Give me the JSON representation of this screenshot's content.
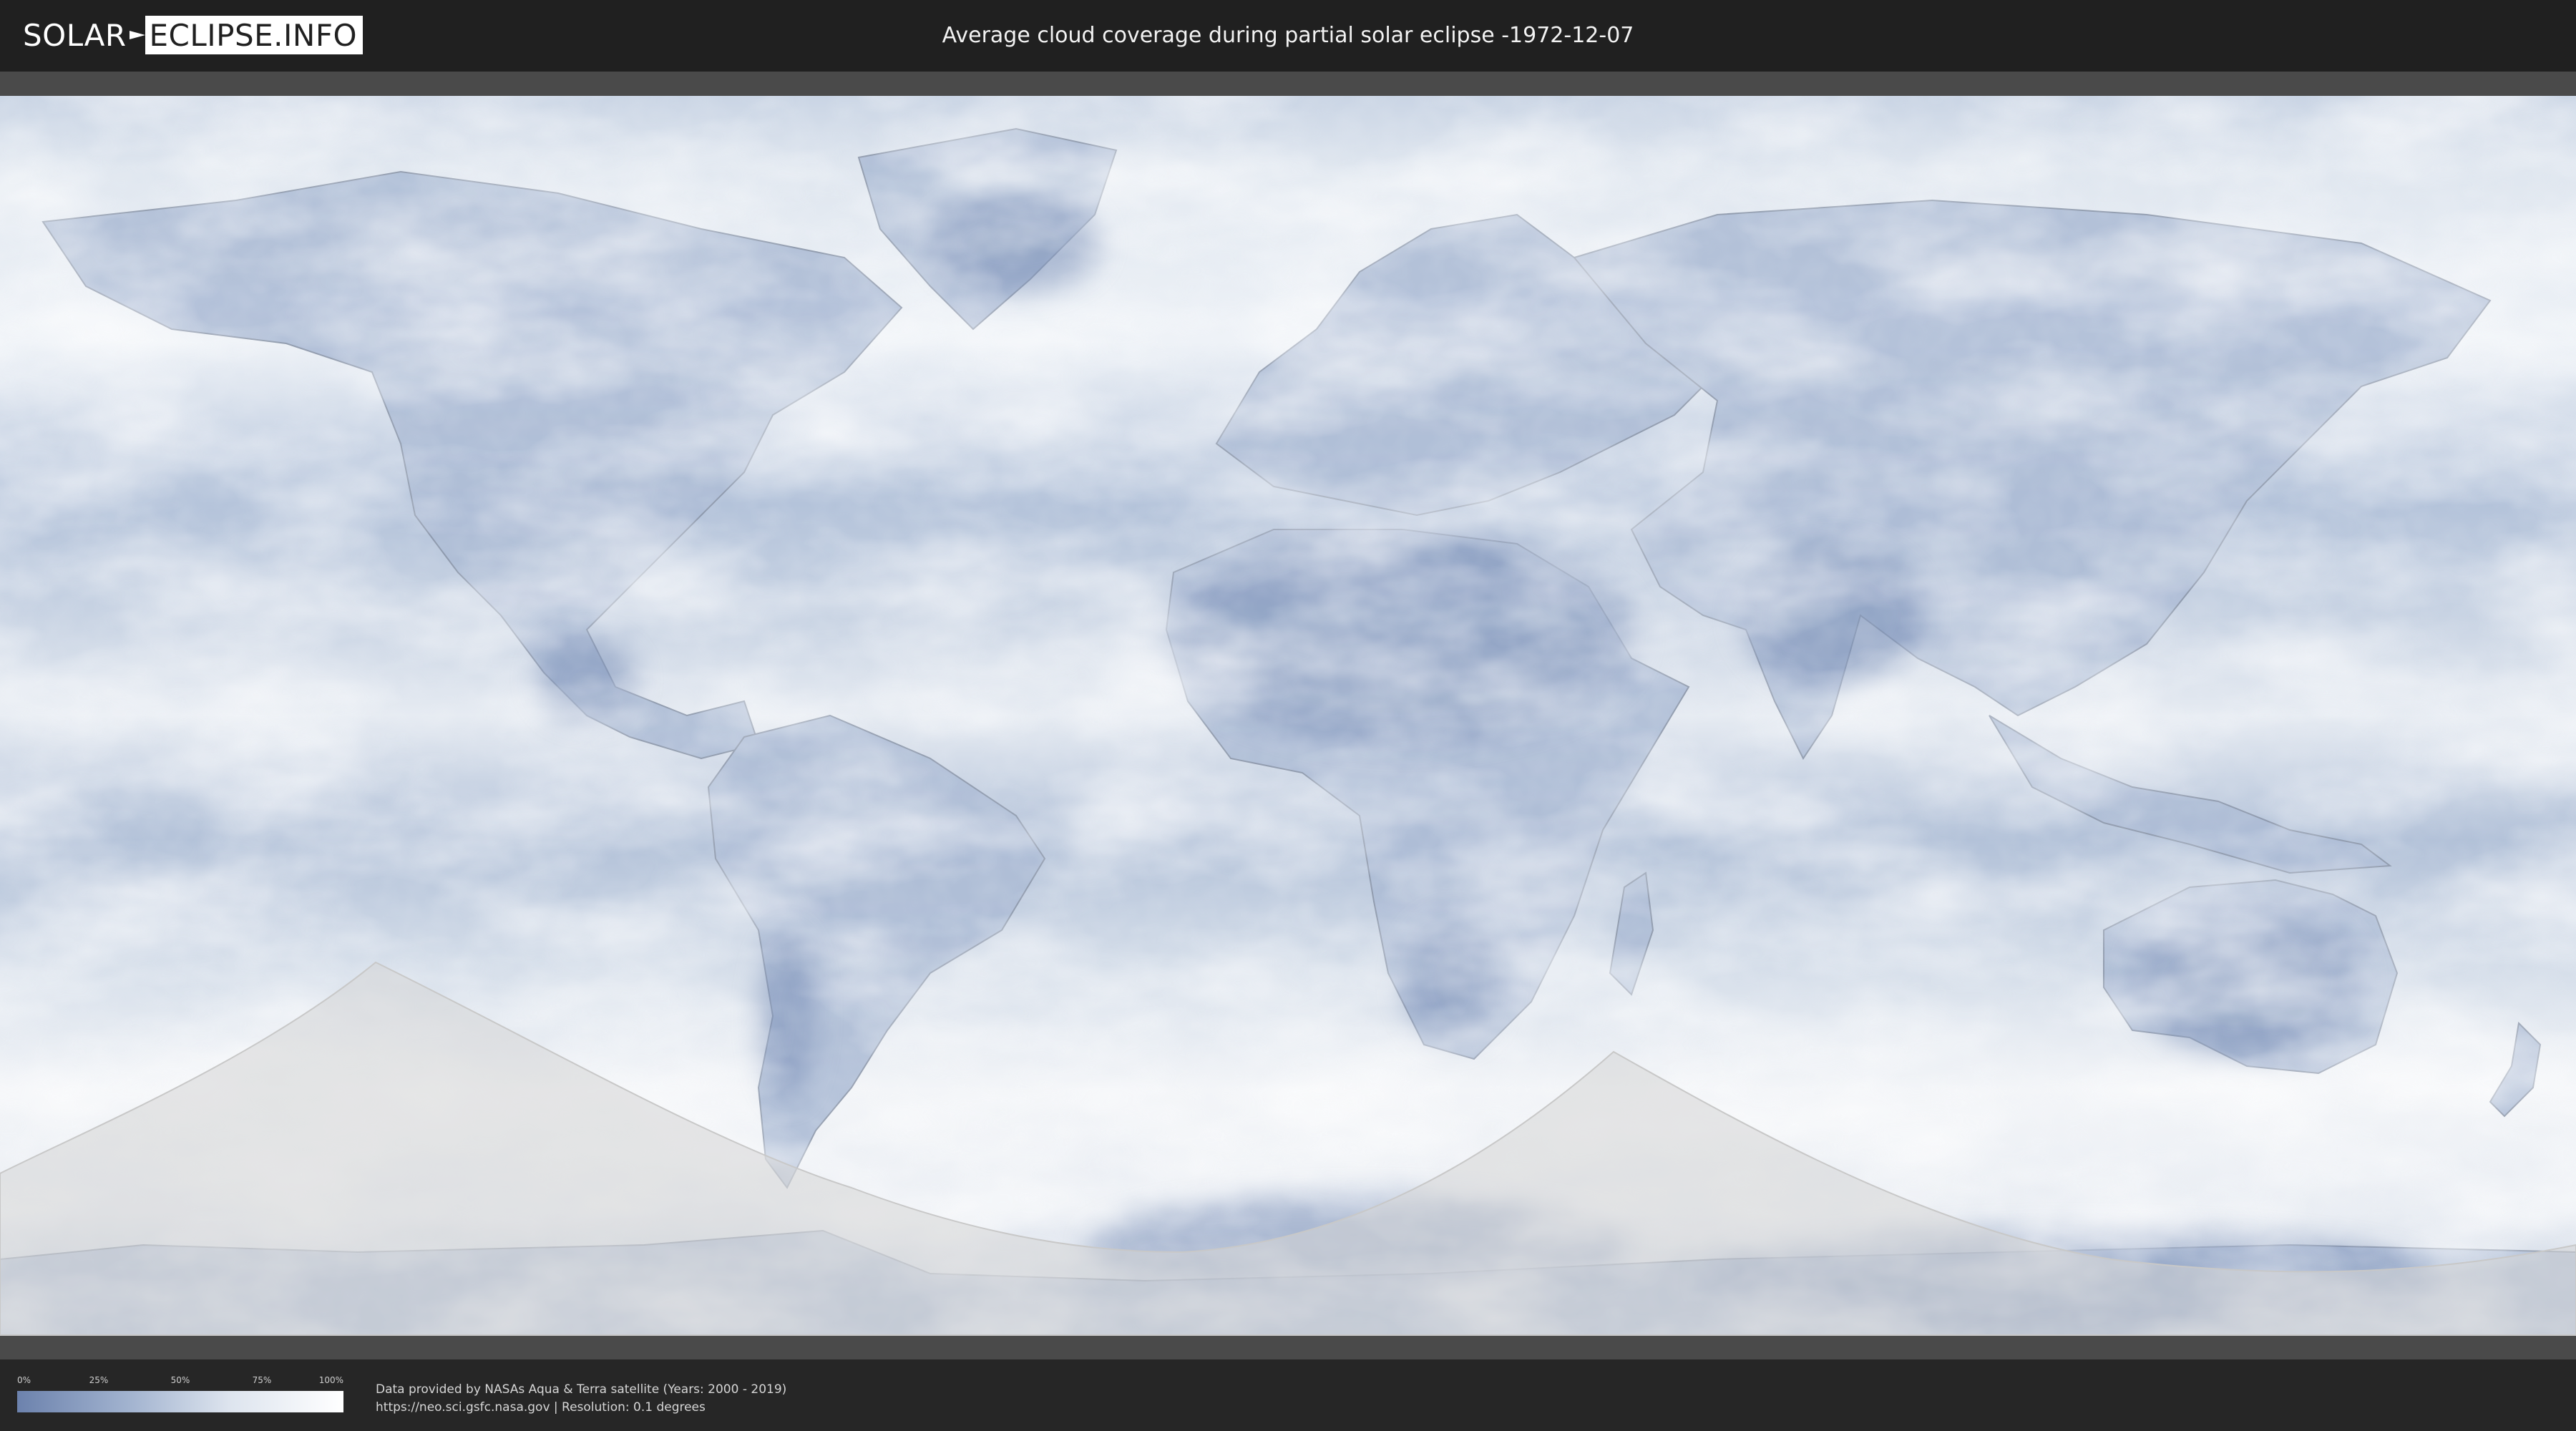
{
  "header": {
    "logo_left": "SOLAR",
    "logo_right": "ECLIPSE.INFO",
    "title": "Average cloud coverage during partial solar eclipse -1972-12-07"
  },
  "map": {
    "projection": "equirectangular",
    "colors": {
      "clear_sky": "#6c82ad",
      "cloud": "#ffffff",
      "eclipse_overlay": "#d9d9d9",
      "border": "#8a95a8"
    }
  },
  "legend": {
    "ticks": [
      "0%",
      "25%",
      "50%",
      "75%",
      "100%"
    ],
    "tick_values": [
      0,
      25,
      50,
      75,
      100
    ],
    "gradient_colors": [
      "#6c82ad",
      "#a3b4d0",
      "#dde4ee",
      "#ffffff"
    ]
  },
  "credits": {
    "line1": "Data provided by NASAs Aqua & Terra satellite (Years: 2000 - 2019)",
    "line2": "https://neo.sci.gsfc.nasa.gov | Resolution: 0.1 degrees"
  }
}
